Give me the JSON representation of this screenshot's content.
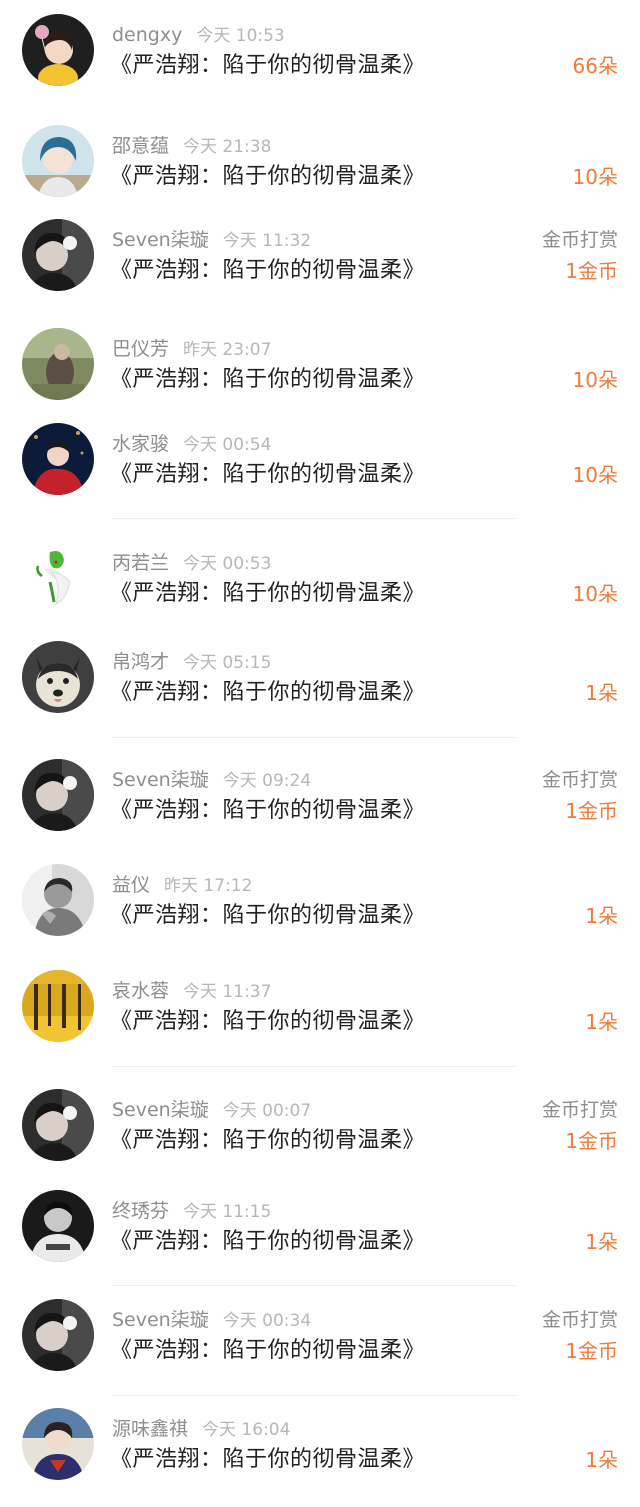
{
  "feed": {
    "accent_color": "#f07a3a",
    "items": [
      {
        "name": "dengxy",
        "time": "今天 10:53",
        "title": "《严浩翔：陷于你的彻骨温柔》",
        "tag": "",
        "amount": "66朵"
      },
      {
        "name": "邵意蕴",
        "time": "今天 21:38",
        "title": "《严浩翔：陷于你的彻骨温柔》",
        "tag": "",
        "amount": "10朵"
      },
      {
        "name": "Seven柒璇",
        "time": "今天 11:32",
        "title": "《严浩翔：陷于你的彻骨温柔》",
        "tag": "金币打赏",
        "amount": "1金币"
      },
      {
        "name": "巴仪芳",
        "time": "昨天 23:07",
        "title": "《严浩翔：陷于你的彻骨温柔》",
        "tag": "",
        "amount": "10朵"
      },
      {
        "name": "水家骏",
        "time": "今天 00:54",
        "title": "《严浩翔：陷于你的彻骨温柔》",
        "tag": "",
        "amount": "10朵"
      },
      {
        "name": "丙若兰",
        "time": "今天 00:53",
        "title": "《严浩翔：陷于你的彻骨温柔》",
        "tag": "",
        "amount": "10朵"
      },
      {
        "name": "帛鸿才",
        "time": "今天 05:15",
        "title": "《严浩翔：陷于你的彻骨温柔》",
        "tag": "",
        "amount": "1朵"
      },
      {
        "name": "Seven柒璇",
        "time": "今天 09:24",
        "title": "《严浩翔：陷于你的彻骨温柔》",
        "tag": "金币打赏",
        "amount": "1金币"
      },
      {
        "name": "益仪",
        "time": "昨天 17:12",
        "title": "《严浩翔：陷于你的彻骨温柔》",
        "tag": "",
        "amount": "1朵"
      },
      {
        "name": "哀水蓉",
        "time": "今天 11:37",
        "title": "《严浩翔：陷于你的彻骨温柔》",
        "tag": "",
        "amount": "1朵"
      },
      {
        "name": "Seven柒璇",
        "time": "今天 00:07",
        "title": "《严浩翔：陷于你的彻骨温柔》",
        "tag": "金币打赏",
        "amount": "1金币"
      },
      {
        "name": "终琇芬",
        "time": "今天 11:15",
        "title": "《严浩翔：陷于你的彻骨温柔》",
        "tag": "",
        "amount": "1朵"
      },
      {
        "name": "Seven柒璇",
        "time": "今天 00:34",
        "title": "《严浩翔：陷于你的彻骨温柔》",
        "tag": "金币打赏",
        "amount": "1金币"
      },
      {
        "name": "源味鑫祺",
        "time": "今天 16:04",
        "title": "《严浩翔：陷于你的彻骨温柔》",
        "tag": "",
        "amount": "1朵"
      }
    ]
  }
}
